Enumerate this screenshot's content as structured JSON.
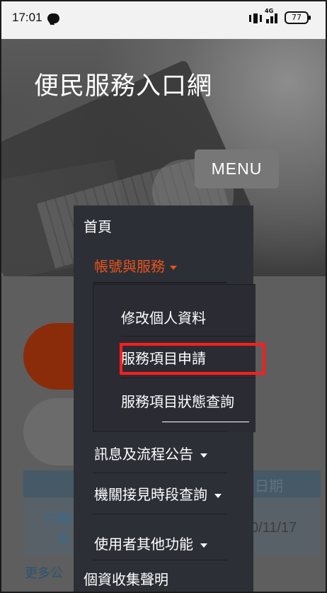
{
  "status_bar": {
    "time": "17:01",
    "line_icon": "line-icon",
    "vibrate_icon": "vibrate-icon",
    "signal_icon": "signal-icon",
    "network_label": "4G",
    "battery": "77"
  },
  "header": {
    "title": "便民服務入口網",
    "menu_button": "MENU"
  },
  "background": {
    "date_header": "日期",
    "row_text_1": "行動",
    "row_text_2": "系",
    "row_date": "0/11/17",
    "more_link": "更多公"
  },
  "dropdown_menu": {
    "home": "首頁",
    "accounts_services": "帳號與服務",
    "submenu": {
      "edit_profile": "修改個人資料",
      "service_application": "服務項目申請",
      "service_status_query": "服務項目狀態查詢"
    },
    "messages_announcements": "訊息及流程公告",
    "agency_reception_query": "機關接見時段查詢",
    "user_other_functions": "使用者其他功能",
    "privacy_statement": "個資收集聲明"
  },
  "colors": {
    "accent": "#e8531d",
    "highlight_border": "#ff1d1d",
    "menu_background": "#2d2f36"
  }
}
